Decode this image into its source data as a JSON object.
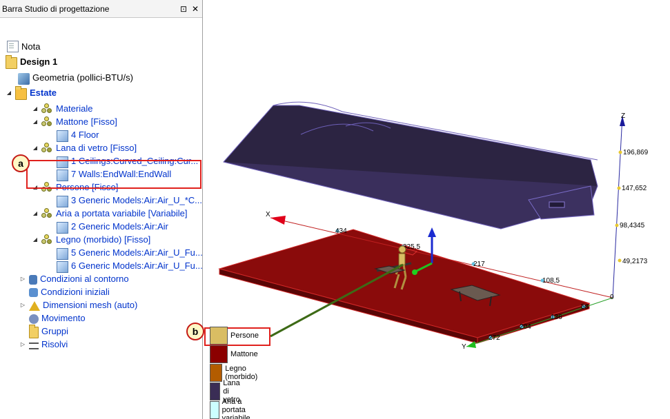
{
  "panel": {
    "title": "Barra Studio di progettazione",
    "pin_glyph": "⊡",
    "close_glyph": "✕"
  },
  "tree": [
    {
      "label": "Nota",
      "icon": "note-icon",
      "expander": "",
      "style": "black"
    },
    {
      "label": "Design 1",
      "icon": "design-folder-icon",
      "expander": "",
      "style": "black-bold"
    },
    {
      "label": "Geometria (pollici-BTU/s)",
      "icon": "geometry-icon",
      "expander": "",
      "style": "black"
    },
    {
      "label": "Estate",
      "icon": "scenario-icon",
      "expander": "◢",
      "style": "blue-bold"
    },
    {
      "label": "Materiale",
      "icon": "material-icon",
      "expander": "◢",
      "style": "blue"
    },
    {
      "label": "Mattone [Fisso]",
      "icon": "material-icon",
      "expander": "◢",
      "style": "blue"
    },
    {
      "label": "4 Floor",
      "icon": "part-cube-icon",
      "expander": "",
      "style": "blue"
    },
    {
      "label": "Lana di vetro [Fisso]",
      "icon": "material-icon",
      "expander": "◢",
      "style": "blue"
    },
    {
      "label": "1 Ceilings:Curved_Ceiling:Cur...",
      "icon": "part-cube-icon",
      "expander": "",
      "style": "blue"
    },
    {
      "label": "7 Walls:EndWall:EndWall",
      "icon": "part-cube-icon",
      "expander": "",
      "style": "blue"
    },
    {
      "label": "Persone [Fisso]",
      "icon": "material-icon",
      "expander": "◢",
      "style": "blue"
    },
    {
      "label": "3 Generic Models:Air:Air_U_*C...",
      "icon": "part-cube-icon",
      "expander": "",
      "style": "blue"
    },
    {
      "label": "Aria a portata variabile [Variabile]",
      "icon": "material-icon",
      "expander": "◢",
      "style": "blue"
    },
    {
      "label": "2 Generic Models:Air:Air",
      "icon": "part-cube-icon",
      "expander": "",
      "style": "blue"
    },
    {
      "label": "Legno (morbido) [Fisso]",
      "icon": "material-icon",
      "expander": "◢",
      "style": "blue"
    },
    {
      "label": "5 Generic Models:Air:Air_U_Fu...",
      "icon": "part-cube-icon",
      "expander": "",
      "style": "blue"
    },
    {
      "label": "6 Generic Models:Air:Air_U_Fu...",
      "icon": "part-cube-icon",
      "expander": "",
      "style": "blue"
    },
    {
      "label": "Condizioni al contorno",
      "icon": "boundary-conditions-icon",
      "expander": "▷",
      "style": "blue"
    },
    {
      "label": "Condizioni iniziali",
      "icon": "initial-conditions-icon",
      "expander": "",
      "style": "blue"
    },
    {
      "label": "Dimensioni mesh (auto)",
      "icon": "mesh-icon",
      "expander": "▷",
      "style": "blue"
    },
    {
      "label": "Movimento",
      "icon": "motion-icon",
      "expander": "",
      "style": "blue"
    },
    {
      "label": "Gruppi",
      "icon": "groups-icon",
      "expander": "",
      "style": "blue"
    },
    {
      "label": "Risolvi",
      "icon": "solve-icon",
      "expander": "▷",
      "style": "blue"
    }
  ],
  "callouts": {
    "a": "a",
    "b": "b"
  },
  "axes": {
    "x_label": "X",
    "y_label": "Y",
    "z_label": "Z",
    "origin": "0",
    "x_ticks": [
      "108,5",
      "217",
      "325,5",
      "434"
    ],
    "y_ticks": [
      "58",
      "136",
      "204",
      "272"
    ],
    "z_ticks": [
      "49,2173",
      "98,4345",
      "147,652",
      "196,869"
    ]
  },
  "legend": [
    {
      "label": "Persone",
      "color": "#d9bd63"
    },
    {
      "label": "Mattone",
      "color": "#8b0000"
    },
    {
      "label": "Legno (morbido)",
      "color": "#b35c00"
    },
    {
      "label": "Lana di vetro",
      "color": "#3a2d55"
    },
    {
      "label": "Aria a portata variabile",
      "color": "#ccffff"
    }
  ],
  "colors": {
    "floor": "#8b0a0a",
    "ceiling": "#2d2546",
    "highlight": "#e0201c",
    "blue_text": "#0033cc"
  }
}
